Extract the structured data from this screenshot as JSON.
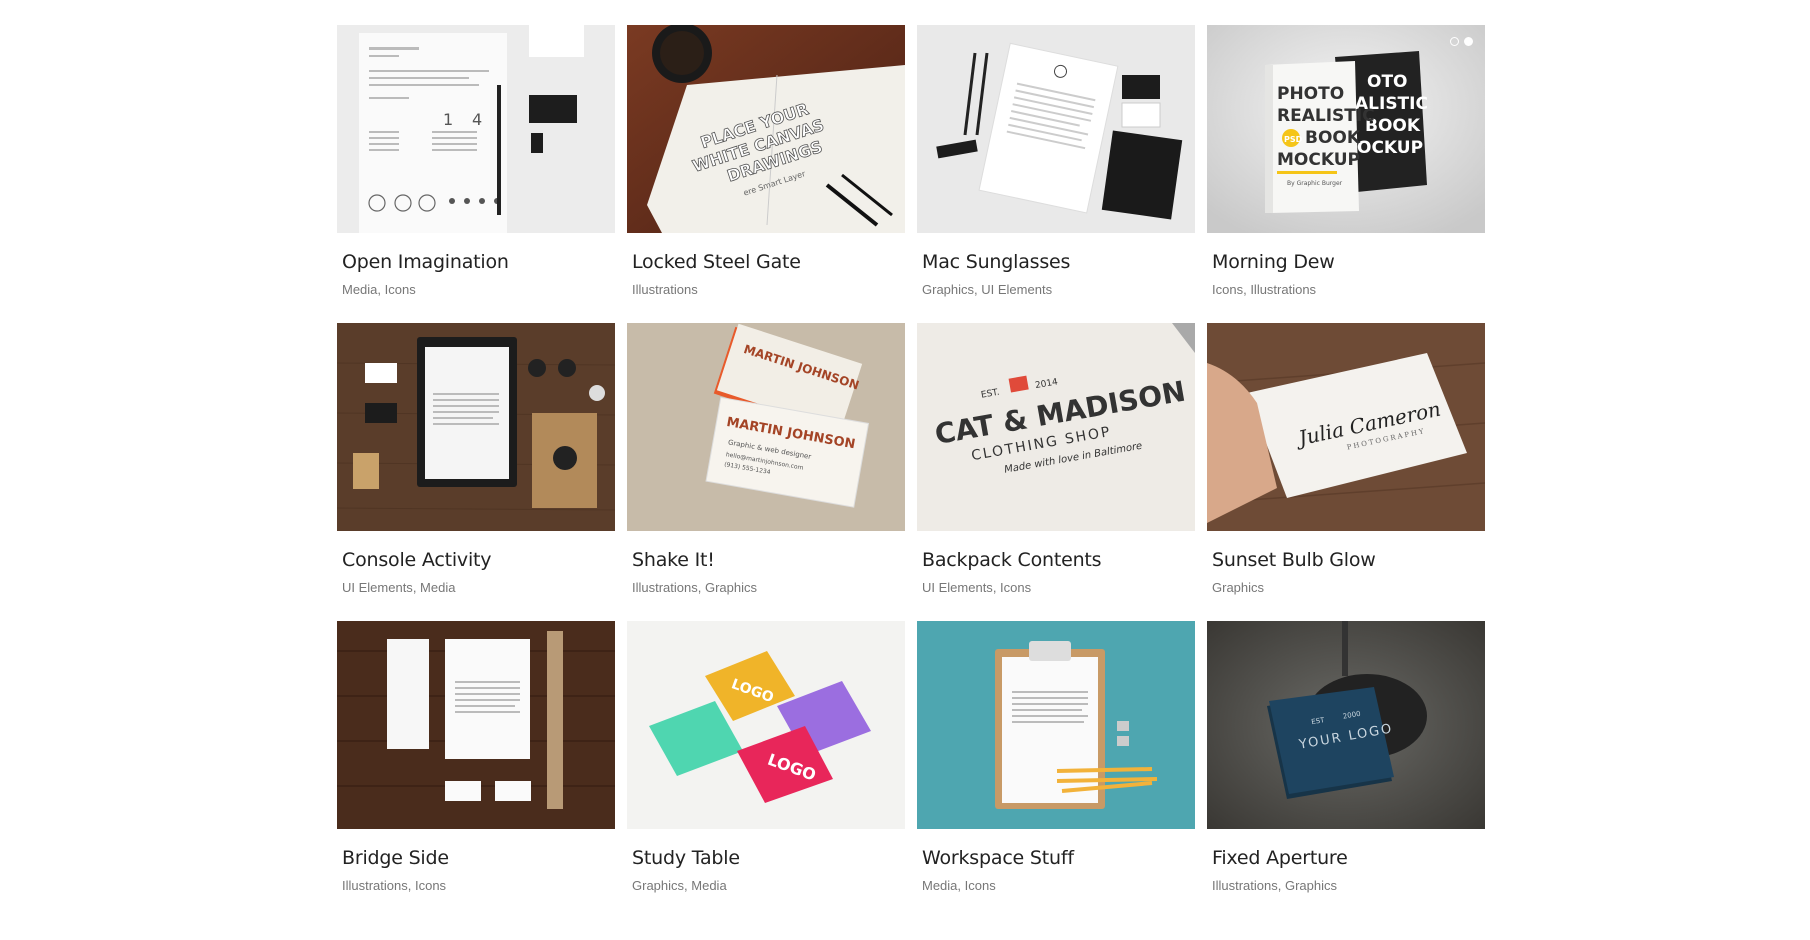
{
  "portfolio": {
    "items": [
      {
        "title": "Open Imagination",
        "categories": [
          "Media",
          "Icons"
        ]
      },
      {
        "title": "Locked Steel Gate",
        "categories": [
          "Illustrations"
        ]
      },
      {
        "title": "Mac Sunglasses",
        "categories": [
          "Graphics",
          "UI Elements"
        ]
      },
      {
        "title": "Morning Dew",
        "categories": [
          "Icons",
          "Illustrations"
        ]
      },
      {
        "title": "Console Activity",
        "categories": [
          "UI Elements",
          "Media"
        ]
      },
      {
        "title": "Shake It!",
        "categories": [
          "Illustrations",
          "Graphics"
        ]
      },
      {
        "title": "Backpack Contents",
        "categories": [
          "UI Elements",
          "Icons"
        ]
      },
      {
        "title": "Sunset Bulb Glow",
        "categories": [
          "Graphics"
        ]
      },
      {
        "title": "Bridge Side",
        "categories": [
          "Illustrations",
          "Icons"
        ]
      },
      {
        "title": "Study Table",
        "categories": [
          "Graphics",
          "Media"
        ]
      },
      {
        "title": "Workspace Stuff",
        "categories": [
          "Media",
          "Icons"
        ]
      },
      {
        "title": "Fixed Aperture",
        "categories": [
          "Illustrations",
          "Graphics"
        ]
      }
    ],
    "image_texts": {
      "steel_gate": [
        "PLACE YOUR",
        "WHITE CANVAS",
        "DRAWINGS",
        "ere Smart Layer"
      ],
      "book": [
        "PHOTO",
        "REALISTIC",
        "BOOK",
        "MOCKUP",
        "By Graphic Burger",
        "PSD"
      ],
      "book_back": [
        "OTO",
        "ALISTIC",
        "BOOK",
        "OCKUP"
      ],
      "martin": [
        "MARTIN JOHNSON",
        "Graphic & web designer",
        "hello@martinjohnson.com",
        "(913) 555-1234"
      ],
      "cat_madison": [
        "EST.",
        "2014",
        "CAT & MADISON",
        "CLOTHING SHOP",
        "Made with love in Baltimore"
      ],
      "julia": [
        "Julia Cameron",
        "PHOTOGRAPHY"
      ],
      "logo": "LOGO",
      "your_logo": [
        "YOUR LOGO",
        "EST",
        "2000"
      ],
      "resume_numbers": [
        "1",
        "4"
      ]
    },
    "slider_dots": 2,
    "slider_active": 2
  },
  "colors": {
    "title": "#222222",
    "categories": "#777777",
    "workspace_bg": "#4ea6b0"
  }
}
